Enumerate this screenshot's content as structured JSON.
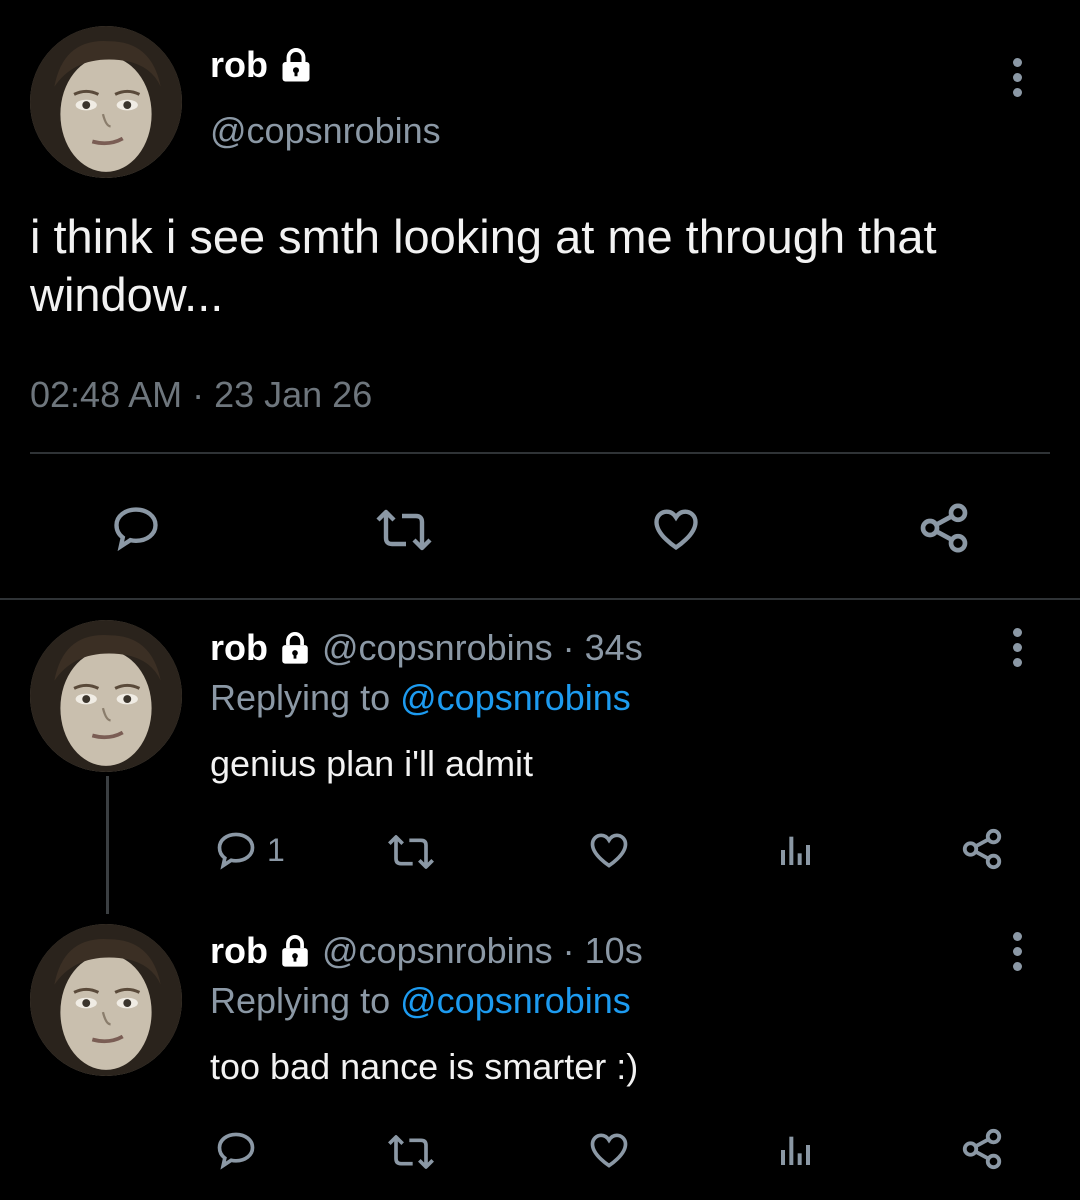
{
  "main_tweet": {
    "display_name": "rob",
    "handle": "@copsnrobins",
    "text": "i think i see smth looking at me through that window...",
    "timestamp": "02:48 AM · 23 Jan 26",
    "actions": {
      "reply_icon": "reply-icon",
      "retweet_icon": "retweet-icon",
      "like_icon": "heart-icon",
      "share_icon": "share-icon"
    }
  },
  "replies": [
    {
      "display_name": "rob",
      "handle_time": "@copsnrobins · 34s",
      "replying_prefix": "Replying to",
      "replying_handle": "@copsnrobins",
      "text": "genius plan i'll admit",
      "reply_count": "1"
    },
    {
      "display_name": "rob",
      "handle_time": "@copsnrobins · 10s",
      "replying_prefix": "Replying to",
      "replying_handle": "@copsnrobins",
      "text": "too bad nance is smarter :)",
      "reply_count": ""
    }
  ],
  "colors": {
    "background": "#000000",
    "text": "#e7e9ea",
    "muted": "#8b98a5",
    "link": "#1d9bf0",
    "divider": "#2f3336"
  }
}
